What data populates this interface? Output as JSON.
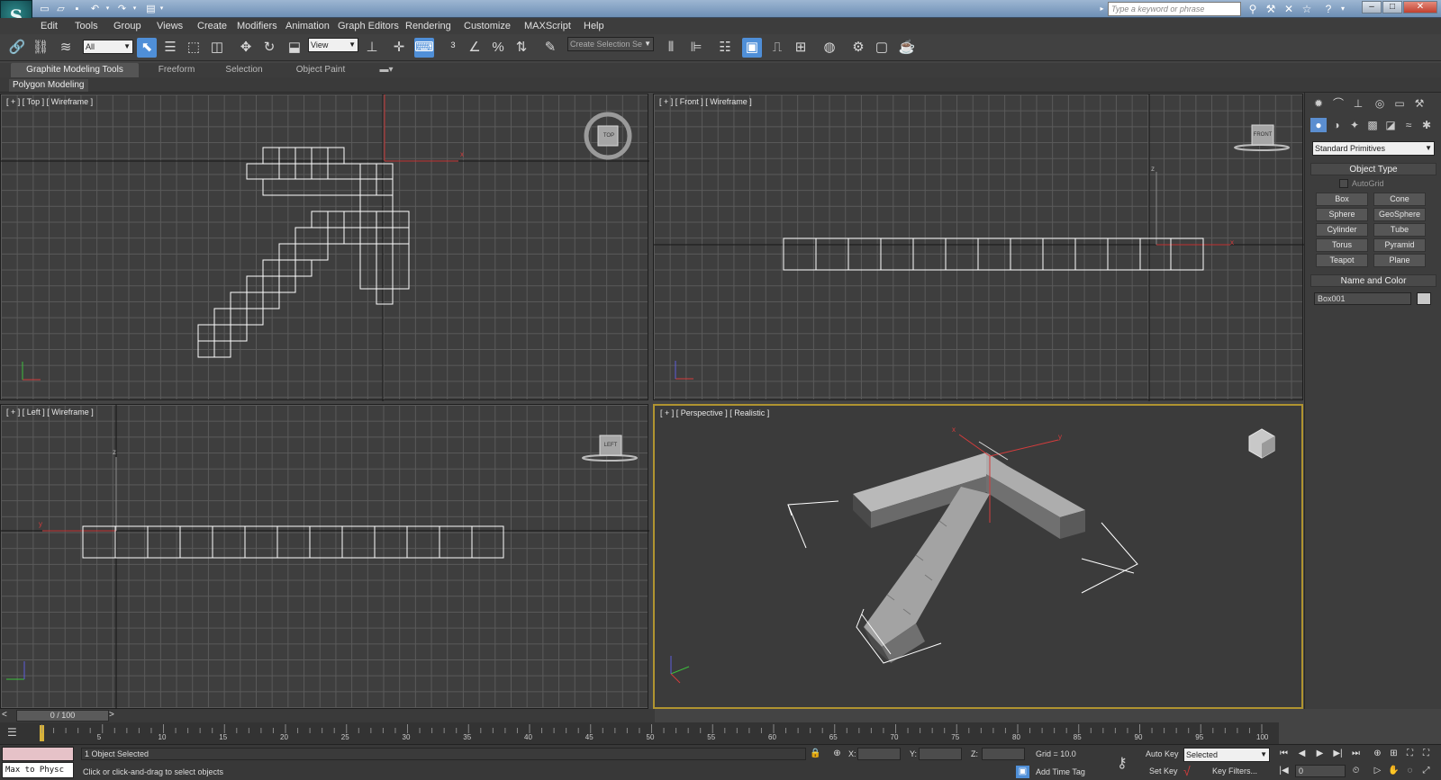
{
  "app": {
    "logo": "S"
  },
  "titlebar": {
    "search_placeholder": "Type a keyword or phrase"
  },
  "menu": [
    "Edit",
    "Tools",
    "Group",
    "Views",
    "Create",
    "Modifiers",
    "Animation",
    "Graph Editors",
    "Rendering",
    "Customize",
    "MAXScript",
    "Help"
  ],
  "toolbar": {
    "filter_value": "All",
    "ref_coord_value": "View",
    "selection_set_placeholder": "Create Selection Se"
  },
  "ribbon": {
    "tabs": [
      "Graphite Modeling Tools",
      "Freeform",
      "Selection",
      "Object Paint"
    ],
    "active_tab": "Graphite Modeling Tools",
    "panel_label": "Polygon Modeling"
  },
  "viewports": {
    "top": {
      "label": "[ + ] [ Top ] [ Wireframe ]",
      "cube": "TOP"
    },
    "front": {
      "label": "[ + ] [ Front ] [ Wireframe ]",
      "cube": "FRONT"
    },
    "left": {
      "label": "[ + ] [ Left ] [ Wireframe ]",
      "cube": "LEFT"
    },
    "perspective": {
      "label": "[ + ] [ Perspective ] [ Realistic ]"
    }
  },
  "axes": {
    "x": "x",
    "y": "y",
    "z": "z"
  },
  "command_panel": {
    "category": "Standard Primitives",
    "object_type_title": "Object Type",
    "autogrid_label": "AutoGrid",
    "buttons": [
      "Box",
      "Cone",
      "Sphere",
      "GeoSphere",
      "Cylinder",
      "Tube",
      "Torus",
      "Pyramid",
      "Teapot",
      "Plane"
    ],
    "name_color_title": "Name and Color",
    "object_name": "Box001",
    "object_color": "#c8c8c8"
  },
  "timeline": {
    "frame_display": "0 / 100",
    "prev": "<",
    "next": ">",
    "ticks": [
      "5",
      "10",
      "15",
      "20",
      "25",
      "30",
      "35",
      "40",
      "45",
      "50",
      "55",
      "60",
      "65",
      "70",
      "75",
      "80",
      "85",
      "90",
      "95",
      "100"
    ]
  },
  "status": {
    "maxscript_text": "Max to Physc",
    "selection_status": "1 Object Selected",
    "prompt": "Click or click-and-drag to select objects",
    "x_label": "X:",
    "y_label": "Y:",
    "z_label": "Z:",
    "grid": "Grid = 10.0",
    "add_time_tag": "Add Time Tag",
    "auto_key": "Auto Key",
    "set_key": "Set Key",
    "key_mode_value": "Selected",
    "key_filters": "Key Filters...",
    "current_frame": "0"
  },
  "colors": {
    "accent": "#4f8fd8",
    "active_viewport_border": "#b09430",
    "axis_red": "#d43c3c",
    "model_grey": "#a8a8a8"
  }
}
